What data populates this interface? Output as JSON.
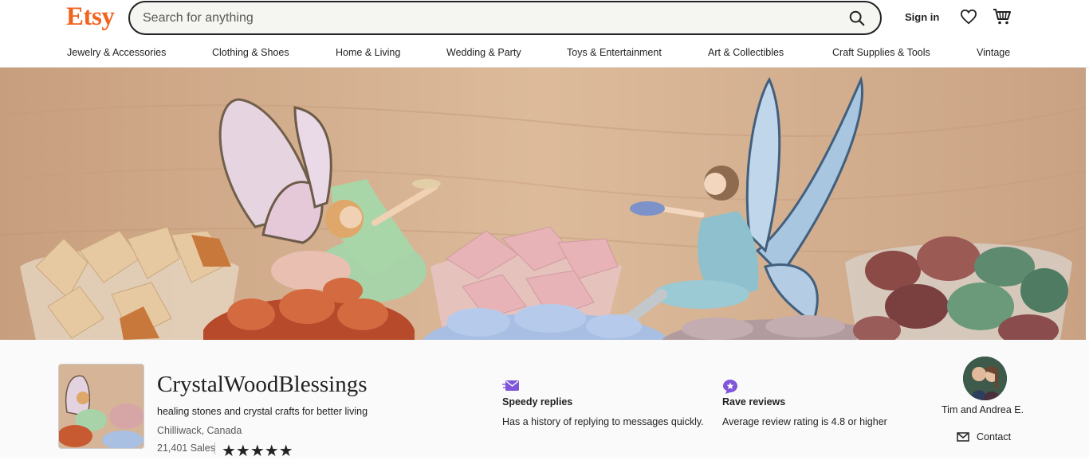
{
  "header": {
    "logo": "Etsy",
    "search_placeholder": "Search for anything",
    "search_icon": "search-icon",
    "signin_label": "Sign in",
    "favorites_icon": "heart-icon",
    "cart_icon": "cart-icon",
    "brand_color": "#F1641E"
  },
  "categories": [
    "Jewelry & Accessories",
    "Clothing & Shoes",
    "Home & Living",
    "Wedding & Party",
    "Toys & Entertainment",
    "Art & Collectibles",
    "Craft Supplies & Tools",
    "Vintage"
  ],
  "shop": {
    "name": "CrystalWoodBlessings",
    "tagline": "healing stones and crystal crafts for better living",
    "location": "Chilliwack, Canada",
    "sales": "21,401 Sales",
    "rating_stars": "★★★★★"
  },
  "badges": [
    {
      "icon": "speedy-replies-icon",
      "title": "Speedy replies",
      "desc": "Has a history of replying to messages quickly."
    },
    {
      "icon": "rave-reviews-icon",
      "title": "Rave reviews",
      "desc": "Average review rating is 4.8 or higher"
    }
  ],
  "owner": {
    "name": "Tim and Andrea E.",
    "contact_label": "Contact",
    "contact_icon": "mail-icon"
  },
  "badge_color": "#7F56D9"
}
